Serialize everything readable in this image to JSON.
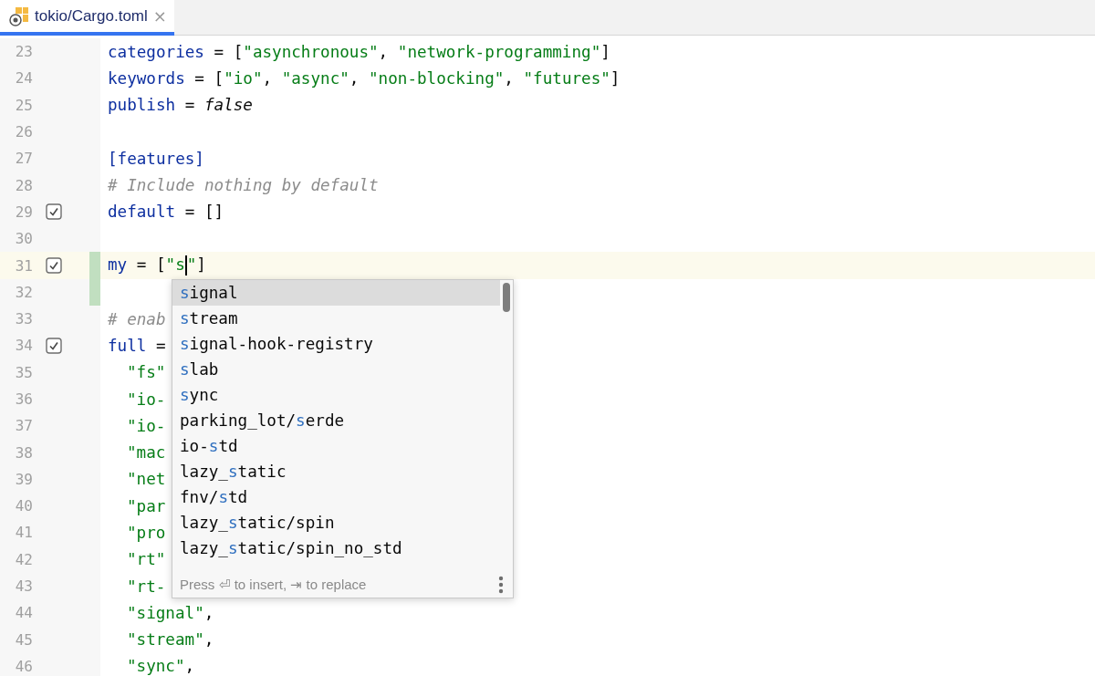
{
  "tab": {
    "title": "tokio/Cargo.toml",
    "selected": true,
    "close": "×"
  },
  "lines": [
    {
      "number": "23",
      "tokens": [
        {
          "kind": "key",
          "text": "categories"
        },
        {
          "kind": "punct",
          "text": " = ["
        },
        {
          "kind": "string",
          "text": "\"asynchronous\""
        },
        {
          "kind": "punct",
          "text": ", "
        },
        {
          "kind": "string",
          "text": "\"network-programming\""
        },
        {
          "kind": "punct",
          "text": "]"
        }
      ]
    },
    {
      "number": "24",
      "tokens": [
        {
          "kind": "key",
          "text": "keywords"
        },
        {
          "kind": "punct",
          "text": " = ["
        },
        {
          "kind": "string",
          "text": "\"io\""
        },
        {
          "kind": "punct",
          "text": ", "
        },
        {
          "kind": "string",
          "text": "\"async\""
        },
        {
          "kind": "punct",
          "text": ", "
        },
        {
          "kind": "string",
          "text": "\"non-blocking\""
        },
        {
          "kind": "punct",
          "text": ", "
        },
        {
          "kind": "string",
          "text": "\"futures\""
        },
        {
          "kind": "punct",
          "text": "]"
        }
      ]
    },
    {
      "number": "25",
      "tokens": [
        {
          "kind": "key",
          "text": "publish"
        },
        {
          "kind": "punct",
          "text": " = "
        },
        {
          "kind": "bool",
          "text": "false"
        }
      ]
    },
    {
      "number": "26"
    },
    {
      "number": "27",
      "tokens": [
        {
          "kind": "section",
          "text": "[features]"
        }
      ]
    },
    {
      "number": "28",
      "tokens": [
        {
          "kind": "comment",
          "text": "# Include nothing by default"
        }
      ]
    },
    {
      "number": "29",
      "checked": true,
      "tokens": [
        {
          "kind": "key",
          "text": "default"
        },
        {
          "kind": "punct",
          "text": " = []"
        }
      ]
    },
    {
      "number": "30"
    },
    {
      "number": "31",
      "checked": true,
      "current": true,
      "changed": true,
      "tokens": [
        {
          "kind": "key",
          "text": "my"
        },
        {
          "kind": "punct",
          "text": " = ["
        },
        {
          "kind": "string",
          "text": "\"s"
        },
        {
          "kind": "caret"
        },
        {
          "kind": "string",
          "text": "\""
        },
        {
          "kind": "punct",
          "text": "]"
        }
      ]
    },
    {
      "number": "32",
      "changed": true
    },
    {
      "number": "33",
      "tokens": [
        {
          "kind": "comment",
          "text": "# enab"
        }
      ]
    },
    {
      "number": "34",
      "checked": true,
      "tokens": [
        {
          "kind": "key",
          "text": "full"
        },
        {
          "kind": "punct",
          "text": " ="
        }
      ]
    },
    {
      "number": "35",
      "indented": true,
      "tokens": [
        {
          "kind": "string",
          "text": "\"fs\""
        }
      ]
    },
    {
      "number": "36",
      "indented": true,
      "tokens": [
        {
          "kind": "string",
          "text": "\"io-"
        }
      ]
    },
    {
      "number": "37",
      "indented": true,
      "tokens": [
        {
          "kind": "string",
          "text": "\"io-"
        }
      ]
    },
    {
      "number": "38",
      "indented": true,
      "tokens": [
        {
          "kind": "string",
          "text": "\"mac"
        }
      ]
    },
    {
      "number": "39",
      "indented": true,
      "tokens": [
        {
          "kind": "string",
          "text": "\"net"
        }
      ]
    },
    {
      "number": "40",
      "indented": true,
      "tokens": [
        {
          "kind": "string",
          "text": "\"par"
        }
      ]
    },
    {
      "number": "41",
      "indented": true,
      "tokens": [
        {
          "kind": "string",
          "text": "\"pro"
        }
      ]
    },
    {
      "number": "42",
      "indented": true,
      "tokens": [
        {
          "kind": "string",
          "text": "\"rt\""
        }
      ]
    },
    {
      "number": "43",
      "indented": true,
      "tokens": [
        {
          "kind": "string",
          "text": "\"rt-"
        }
      ]
    },
    {
      "number": "44",
      "indented": true,
      "tokens": [
        {
          "kind": "string",
          "text": "\"signal\""
        },
        {
          "kind": "punct",
          "text": ","
        }
      ]
    },
    {
      "number": "45",
      "indented": true,
      "tokens": [
        {
          "kind": "string",
          "text": "\"stream\""
        },
        {
          "kind": "punct",
          "text": ","
        }
      ]
    },
    {
      "number": "46",
      "indented": true,
      "tokens": [
        {
          "kind": "string",
          "text": "\"sync\""
        },
        {
          "kind": "punct",
          "text": ","
        }
      ]
    }
  ],
  "completion": {
    "items": [
      {
        "match": "s",
        "after": "ignal",
        "selected": true
      },
      {
        "match": "s",
        "after": "tream",
        "selected": false
      },
      {
        "match": "s",
        "after": "ignal-hook-registry",
        "selected": false
      },
      {
        "match": "s",
        "after": "lab",
        "selected": false
      },
      {
        "match": "s",
        "after": "ync",
        "selected": false
      },
      {
        "before": "parking_lot/",
        "match": "s",
        "after": "erde",
        "selected": false
      },
      {
        "before": "io-",
        "match": "s",
        "after": "td",
        "selected": false
      },
      {
        "before": "lazy_",
        "match": "s",
        "after": "tatic",
        "selected": false
      },
      {
        "before": "fnv/",
        "match": "s",
        "after": "td",
        "selected": false
      },
      {
        "before": "lazy_",
        "match": "s",
        "after": "tatic/spin",
        "selected": false
      },
      {
        "before": "lazy_",
        "match": "s",
        "after": "tatic/spin_no_std",
        "selected": false
      }
    ],
    "hint": "Press ⏎ to insert, ⇥ to replace"
  }
}
